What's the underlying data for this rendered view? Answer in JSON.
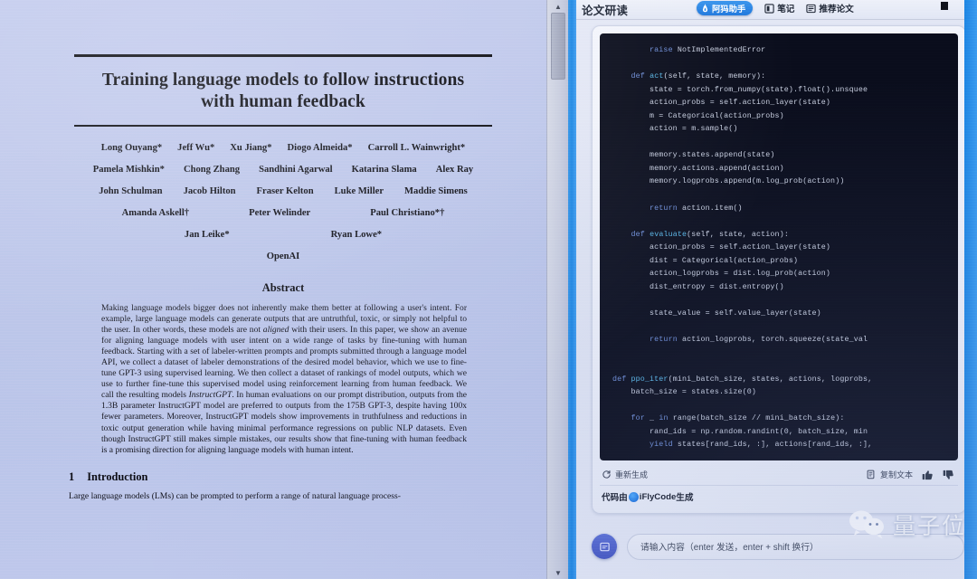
{
  "paper": {
    "title": "Training language models to follow instructions\nwith human feedback",
    "title_line1": "Training language models to follow instructions",
    "title_line2": "with human feedback",
    "author_rows": [
      [
        "Long Ouyang*",
        "Jeff Wu*",
        "Xu Jiang*",
        "Diogo Almeida*",
        "Carroll L. Wainwright*"
      ],
      [
        "Pamela Mishkin*",
        "Chong Zhang",
        "Sandhini Agarwal",
        "Katarina Slama",
        "Alex Ray"
      ],
      [
        "John Schulman",
        "Jacob Hilton",
        "Fraser Kelton",
        "Luke Miller",
        "Maddie Simens"
      ],
      [
        "Amanda Askell†",
        "Peter Welinder",
        "Paul Christiano*†"
      ],
      [
        "Jan Leike*",
        "Ryan Lowe*"
      ],
      [
        "OpenAI"
      ]
    ],
    "abstract_heading": "Abstract",
    "abstract_text": "Making language models bigger does not inherently make them better at following a user's intent. For example, large language models can generate outputs that are untruthful, toxic, or simply not helpful to the user. In other words, these models are not aligned with their users. In this paper, we show an avenue for aligning language models with user intent on a wide range of tasks by fine-tuning with human feedback. Starting with a set of labeler-written prompts and prompts submitted through a language model API, we collect a dataset of labeler demonstrations of the desired model behavior, which we use to fine-tune GPT-3 using supervised learning. We then collect a dataset of rankings of model outputs, which we use to further fine-tune this supervised model using reinforcement learning from human feedback. We call the resulting models InstructGPT. In human evaluations on our prompt distribution, outputs from the 1.3B parameter InstructGPT model are preferred to outputs from the 175B GPT-3, despite having 100x fewer parameters. Moreover, InstructGPT models show improvements in truthfulness and reductions in toxic output generation while having minimal performance regressions on public NLP datasets. Even though InstructGPT still makes simple mistakes, our results show that fine-tuning with human feedback is a promising direction for aligning language models with human intent.",
    "section_number": "1",
    "section_title": "Introduction",
    "intro_text": "Large language models (LMs) can be prompted to perform a range of natural language process-"
  },
  "scrollbar": {
    "up_arrow": "▲",
    "down_arrow": "▼"
  },
  "chat": {
    "title": "论文研读",
    "assistant_pill_label": "阿犸助手",
    "header_items": [
      {
        "label": "笔记",
        "icon": "note-icon"
      },
      {
        "label": "推荐论文",
        "icon": "recommend-paper-icon"
      }
    ],
    "code": "        raise NotImplementedError\n\n    def act(self, state, memory):\n        state = torch.from_numpy(state).float().unsquee\n        action_probs = self.action_layer(state)\n        m = Categorical(action_probs)\n        action = m.sample()\n\n        memory.states.append(state)\n        memory.actions.append(action)\n        memory.logprobs.append(m.log_prob(action))\n\n        return action.item()\n\n    def evaluate(self, state, action):\n        action_probs = self.action_layer(state)\n        dist = Categorical(action_probs)\n        action_logprobs = dist.log_prob(action)\n        dist_entropy = dist.entropy()\n\n        state_value = self.value_layer(state)\n\n        return action_logprobs, torch.squeeze(state_val\n\n\ndef ppo_iter(mini_batch_size, states, actions, logprobs,\n    batch_size = states.size(0)\n\n    for _ in range(batch_size // mini_batch_size):\n        rand_ids = np.random.randint(0, batch_size, min\n        yield states[rand_ids, :], actions[rand_ids, :],",
    "actions": {
      "regenerate": "重新生成",
      "copy_text": "复制文本",
      "thumb_up": "thumbs-up-icon",
      "thumb_down": "thumbs-down-icon"
    },
    "footer_prefix": "代码由",
    "footer_brand": "iFlyCode",
    "footer_suffix": "生成",
    "input_placeholder": "请输入内容（enter 发送，enter + shift 换行）"
  },
  "watermark": {
    "text": "量子位",
    "icon": "wechat-icon"
  },
  "colors": {
    "accent_blue": "#1a86e3",
    "pill_blue": "#2f8ce9",
    "code_bg": "#0a0d1c",
    "paper_bg": "#bcc6ec"
  }
}
